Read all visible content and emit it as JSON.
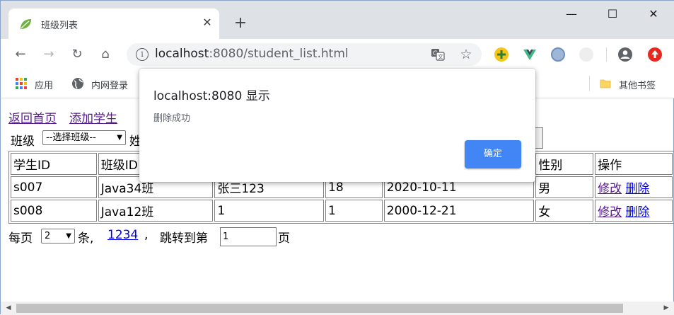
{
  "browser": {
    "tab_title": "班级列表",
    "tab_close": "✕",
    "new_tab": "+",
    "window_minimize": "—",
    "window_maximize": "☐",
    "window_close": "✕",
    "url_host": "localhost",
    "url_rest": ":8080/student_list.html",
    "bookmarks": {
      "apps": "应用",
      "intranet": "内网登录",
      "other": "其他书签"
    }
  },
  "page": {
    "links": {
      "home": "返回首页",
      "add_student": "添加学生"
    },
    "filter": {
      "class_label": "班级",
      "class_select": "--选择班级--",
      "name_label_partial": "姓"
    },
    "table": {
      "headers": [
        "学生ID",
        "班级ID",
        "",
        "",
        "",
        "性别",
        "操作"
      ],
      "rows": [
        {
          "id": "s007",
          "class": "Java34班",
          "name": "张三123",
          "age": "18",
          "date": "2020-10-11",
          "gender": "男"
        },
        {
          "id": "s008",
          "class": "Java12班",
          "name": "1",
          "age": "1",
          "date": "2000-12-21",
          "gender": "女"
        }
      ],
      "edit_label": "修改",
      "delete_label": "删除"
    },
    "pagination": {
      "per_page_label": "每页",
      "per_page_value": "2",
      "unit": "条,",
      "pages": "1234",
      "comma": ",",
      "jump_label": "跳转到第",
      "jump_value": "1",
      "page_suffix": "页"
    }
  },
  "dialog": {
    "title": "localhost:8080 显示",
    "message": "删除成功",
    "ok_label": "确定",
    "ok_color": "#4285f4"
  }
}
